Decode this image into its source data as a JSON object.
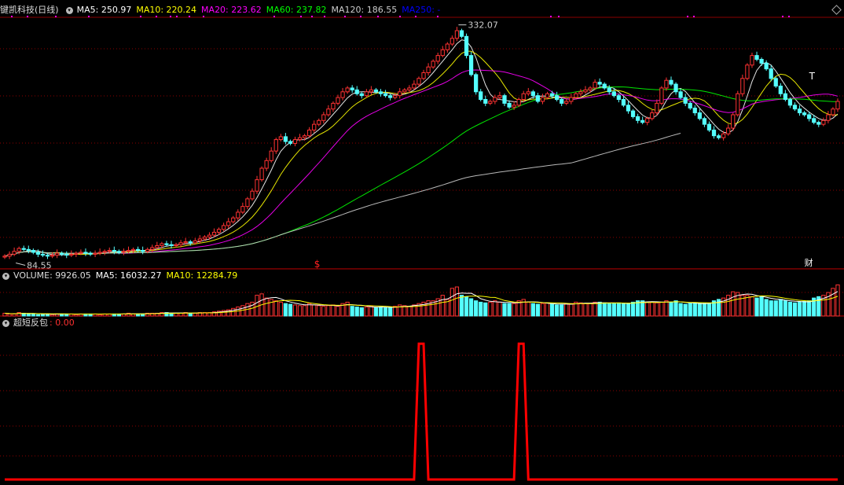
{
  "header": {
    "stock_name": "键凯科技(日线)",
    "ma": [
      {
        "label": "MA5:",
        "value": "250.97",
        "color": "#ffffff"
      },
      {
        "label": "MA10:",
        "value": "220.24",
        "color": "#ffff00"
      },
      {
        "label": "MA20:",
        "value": "223.62",
        "color": "#ff00ff"
      },
      {
        "label": "MA60:",
        "value": "237.82",
        "color": "#00ff00"
      },
      {
        "label": "MA120:",
        "value": "186.55",
        "color": "#cccccc"
      },
      {
        "label": "MA250:",
        "value": "-",
        "color": "#0000ff"
      }
    ]
  },
  "volume_header": {
    "label": "VOLUME:",
    "value": "9926.05",
    "ma5_label": "MA5:",
    "ma5_value": "16032.27",
    "ma10_label": "MA10:",
    "ma10_value": "12284.79"
  },
  "indicator_header": {
    "name": "超短反包",
    "value": ": 0.00"
  },
  "annotations": {
    "high": "332.07",
    "low": "84.55",
    "s_mark": "$",
    "cai_mark": "财",
    "t_mark": "T"
  },
  "colors": {
    "up": "#ff3232",
    "down": "#54ffff",
    "grid": "#8b0000",
    "indicator": "#ff0000"
  },
  "chart_data": [
    {
      "type": "candlestick",
      "title": "键凯科技(日线)",
      "x": [
        0,
        1,
        2,
        3,
        4,
        5,
        6,
        7,
        8,
        9,
        10,
        11,
        12,
        13,
        14,
        15,
        16,
        17,
        18,
        19,
        20,
        21,
        22,
        23,
        24,
        25,
        26,
        27,
        28,
        29,
        30,
        31,
        32,
        33,
        34,
        35,
        36,
        37,
        38,
        39,
        40,
        41,
        42,
        43,
        44,
        45,
        46,
        47,
        48,
        49,
        50,
        51,
        52,
        53,
        54,
        55,
        56,
        57,
        58,
        59,
        60,
        61,
        62,
        63,
        64,
        65,
        66,
        67,
        68,
        69,
        70,
        71,
        72,
        73,
        74,
        75,
        76,
        77,
        78,
        79,
        80,
        81,
        82,
        83,
        84,
        85,
        86,
        87,
        88,
        89,
        90,
        91,
        92,
        93,
        94,
        95,
        96,
        97,
        98,
        99,
        100,
        101,
        102,
        103,
        104,
        105,
        106,
        107,
        108,
        109,
        110,
        111,
        112,
        113,
        114,
        115,
        116,
        117,
        118,
        119,
        120,
        121,
        122,
        123,
        124,
        125,
        126,
        127,
        128,
        129,
        130,
        131,
        132,
        133,
        134,
        135,
        136,
        137,
        138,
        139,
        140,
        141,
        142,
        143,
        144,
        145,
        146,
        147,
        148,
        149,
        150,
        151,
        152,
        153,
        154,
        155,
        156,
        157,
        158,
        159,
        160,
        161,
        162,
        163,
        164,
        165,
        166,
        167,
        168,
        169,
        170,
        171,
        172,
        173,
        174,
        175
      ],
      "close": [
        90,
        92,
        95,
        98,
        97,
        96,
        94,
        92,
        91,
        90,
        91,
        93,
        92,
        91,
        92,
        93,
        94,
        93,
        92,
        93,
        94,
        95,
        96,
        95,
        94,
        95,
        96,
        97,
        96,
        95,
        97,
        99,
        101,
        103,
        102,
        101,
        102,
        104,
        105,
        104,
        106,
        108,
        110,
        112,
        115,
        118,
        122,
        126,
        130,
        136,
        142,
        150,
        158,
        170,
        182,
        190,
        200,
        212,
        215,
        210,
        208,
        212,
        214,
        216,
        222,
        228,
        232,
        238,
        244,
        250,
        256,
        262,
        266,
        264,
        260,
        258,
        262,
        264,
        262,
        260,
        258,
        256,
        258,
        262,
        264,
        266,
        270,
        276,
        282,
        288,
        294,
        300,
        306,
        312,
        318,
        326,
        320,
        300,
        280,
        262,
        254,
        250,
        252,
        256,
        258,
        250,
        246,
        248,
        254,
        260,
        262,
        258,
        252,
        256,
        260,
        258,
        254,
        250,
        252,
        256,
        260,
        262,
        264,
        266,
        272,
        270,
        266,
        262,
        258,
        254,
        248,
        242,
        236,
        232,
        230,
        234,
        240,
        250,
        266,
        274,
        270,
        262,
        256,
        250,
        245,
        240,
        234,
        228,
        222,
        216,
        214,
        218,
        224,
        238,
        260,
        276,
        290,
        300,
        296,
        292,
        286,
        276,
        268,
        260,
        254,
        248,
        244,
        240,
        238,
        234,
        230,
        228,
        232,
        238,
        244,
        252
      ],
      "ylim": [
        80,
        340
      ],
      "annotations": [
        {
          "x": 95,
          "y": 332.07,
          "text": "332.07"
        },
        {
          "x": 2,
          "y": 84.55,
          "text": "84.55"
        }
      ]
    },
    {
      "type": "line",
      "title": "MA",
      "series": [
        {
          "name": "MA5",
          "color": "#ffffff"
        },
        {
          "name": "MA10",
          "color": "#ffff00"
        },
        {
          "name": "MA20",
          "color": "#ff00ff"
        },
        {
          "name": "MA60",
          "color": "#00ff00"
        },
        {
          "name": "MA120",
          "color": "#cccccc"
        }
      ]
    },
    {
      "type": "bar",
      "title": "VOLUME",
      "values": [
        4,
        3,
        3,
        5,
        4,
        3,
        3,
        2,
        3,
        3,
        2,
        3,
        3,
        3,
        3,
        2,
        3,
        3,
        3,
        3,
        2,
        3,
        3,
        3,
        3,
        3,
        4,
        3,
        3,
        3,
        4,
        4,
        4,
        5,
        5,
        4,
        4,
        4,
        5,
        4,
        4,
        5,
        5,
        5,
        6,
        7,
        8,
        9,
        11,
        13,
        15,
        18,
        20,
        30,
        32,
        26,
        24,
        22,
        20,
        18,
        17,
        16,
        15,
        15,
        18,
        16,
        15,
        14,
        15,
        16,
        14,
        18,
        20,
        14,
        13,
        12,
        13,
        14,
        12,
        13,
        12,
        12,
        14,
        16,
        15,
        14,
        16,
        18,
        20,
        22,
        22,
        25,
        30,
        24,
        40,
        42,
        30,
        28,
        25,
        22,
        20,
        19,
        20,
        22,
        20,
        18,
        18,
        18,
        22,
        24,
        20,
        18,
        17,
        18,
        19,
        17,
        16,
        16,
        18,
        18,
        20,
        19,
        18,
        18,
        20,
        20,
        19,
        18,
        18,
        19,
        18,
        18,
        20,
        22,
        22,
        20,
        20,
        19,
        20,
        22,
        20,
        22,
        18,
        17,
        18,
        19,
        18,
        18,
        18,
        22,
        24,
        26,
        30,
        35,
        34,
        30,
        30,
        28,
        26,
        28,
        24,
        22,
        22,
        24,
        22,
        20,
        19,
        20,
        21,
        22,
        26,
        28,
        30,
        34,
        40,
        45
      ],
      "ylim": [
        0,
        50
      ]
    },
    {
      "type": "line",
      "title": "超短反包",
      "x": [
        0,
        86,
        87,
        88,
        89,
        107,
        108,
        109,
        110,
        175
      ],
      "values": [
        0,
        0,
        1,
        1,
        0,
        0,
        1,
        1,
        0,
        0
      ],
      "ylim": [
        0,
        1.1
      ]
    }
  ]
}
